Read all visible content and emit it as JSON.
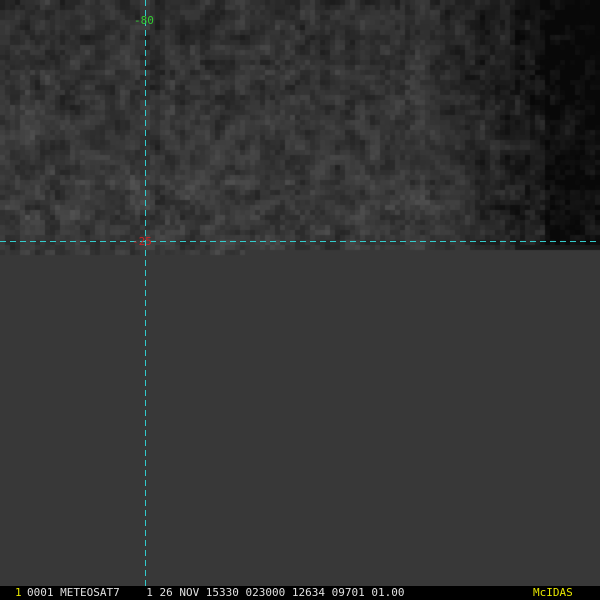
{
  "image": {
    "description_colors": {
      "background": "#3a3a3a",
      "crosshair": "#33cccc",
      "longitude_label": "#33cc33",
      "latitude_label": "#cc2222",
      "frame_number": "#e6e600",
      "status_text": "#e0e0e0",
      "brand": "#e6e600"
    }
  },
  "grid": {
    "longitude_label": "-80",
    "latitude_label": "-25"
  },
  "status_bar": {
    "frame_number": "1",
    "text": "0001 METEOSAT7    1 26 NOV 15330 023000 12634 09701 01.00",
    "brand": "McIDAS"
  }
}
